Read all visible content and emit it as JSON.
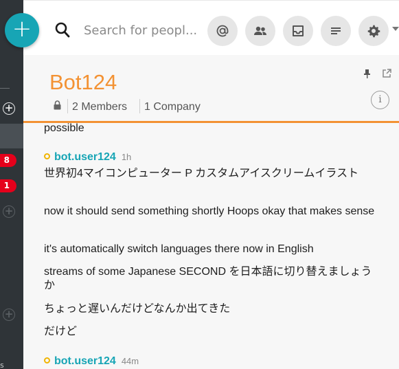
{
  "compose": {
    "label": "+"
  },
  "sidebar": {
    "badges": [
      "8",
      "1"
    ],
    "bottom_text": "s"
  },
  "search": {
    "placeholder": "Search for peopl..."
  },
  "toolbar": {
    "buttons": [
      "mentions-icon",
      "people-icon",
      "inbox-icon",
      "list-icon",
      "settings-icon"
    ]
  },
  "conversation": {
    "title": "Bot124",
    "members": "2 Members",
    "companies": "1 Company",
    "info_label": "i"
  },
  "messages": [
    {
      "text": "possible"
    },
    {
      "author": "bot.user124",
      "time": "1h"
    },
    {
      "text": "世界初4マイコンピューター P カスタムアイスクリームイラスト"
    },
    {
      "text": "now it should send something shortly Hoops okay that makes sense"
    },
    {
      "text": "it's automatically switch languages there now in English"
    },
    {
      "text": "streams of some Japanese SECOND を日本語に切り替えましょうか"
    },
    {
      "text": "ちょっと遅いんだけどなんか出てきた"
    },
    {
      "text": "だけど"
    },
    {
      "author": "bot.user124",
      "time": "44m"
    }
  ],
  "colors": {
    "accent": "#f39233",
    "teal": "#17a5b5",
    "sidebar": "#2f3438",
    "badge": "#e5001b"
  }
}
